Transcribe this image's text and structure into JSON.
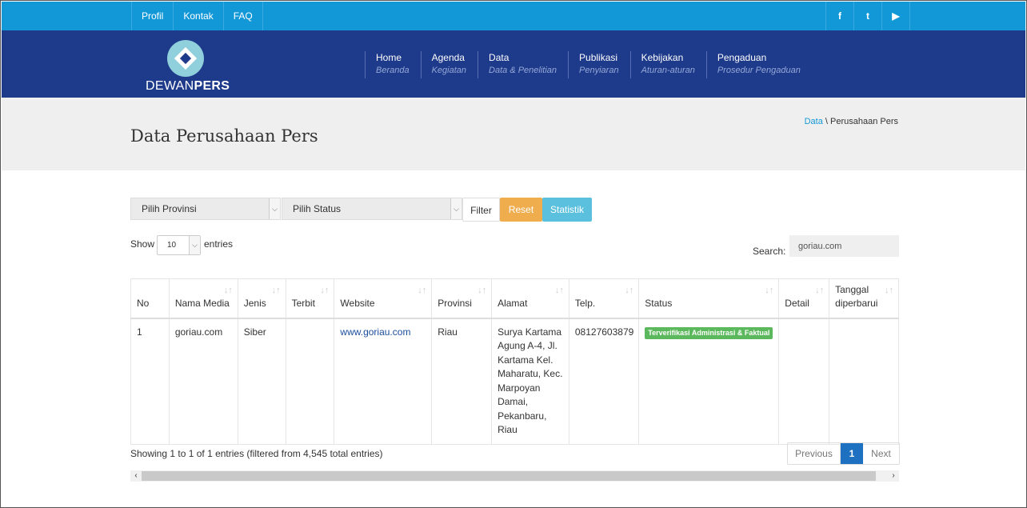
{
  "topbar": {
    "links": [
      "Profil",
      "Kontak",
      "FAQ"
    ],
    "social_icons": [
      "facebook-icon",
      "twitter-icon",
      "youtube-icon"
    ],
    "social_glyphs": [
      "f",
      "t",
      "▶"
    ]
  },
  "logo": {
    "text_a": "DEWAN",
    "text_b": "PERS"
  },
  "nav": [
    {
      "title": "Home",
      "subtitle": "Beranda"
    },
    {
      "title": "Agenda",
      "subtitle": "Kegiatan"
    },
    {
      "title": "Data",
      "subtitle": "Data & Penelitian"
    },
    {
      "title": "Publikasi",
      "subtitle": "Penyiaran"
    },
    {
      "title": "Kebijakan",
      "subtitle": "Aturan-aturan"
    },
    {
      "title": "Pengaduan",
      "subtitle": "Prosedur Pengaduan"
    }
  ],
  "page": {
    "title": "Data Perusahaan Pers",
    "breadcrumb_link": "Data",
    "breadcrumb_sep": " \\ ",
    "breadcrumb_current": "Perusahaan Pers"
  },
  "filters": {
    "province": "Pilih Provinsi",
    "status": "Pilih Status",
    "filter_btn": "Filter",
    "reset_btn": "Reset",
    "stat_btn": "Statistik"
  },
  "length": {
    "show_label": "Show",
    "value": "10",
    "entries_label": "entries"
  },
  "search": {
    "label": "Search:",
    "value": "goriau.com"
  },
  "table": {
    "headers": [
      "No",
      "Nama Media",
      "Jenis",
      "Terbit",
      "Website",
      "Provinsi",
      "Alamat",
      "Telp.",
      "Status",
      "Detail",
      "Tanggal diperbarui"
    ],
    "rows": [
      {
        "no": "1",
        "nama": "goriau.com",
        "jenis": "Siber",
        "terbit": "",
        "website": "www.goriau.com",
        "provinsi": "Riau",
        "alamat": "Surya Kartama Agung A-4, Jl. Kartama Kel. Maharatu, Kec. Marpoyan Damai, Pekanbaru, Riau",
        "telp": "08127603879",
        "status": "Terverifikasi Administrasi & Faktual",
        "detail": "",
        "tanggal": ""
      }
    ]
  },
  "info": "Showing 1 to 1 of 1 entries (filtered from 4,545 total entries)",
  "pager": {
    "prev": "Previous",
    "current": "1",
    "next": "Next"
  },
  "colors": {
    "topbar": "#1398d7",
    "navbar": "#1e3a8a",
    "reset": "#f0ad4e",
    "statistik": "#5bc0de",
    "badge": "#5cb85c",
    "page_active": "#1e70c1"
  }
}
